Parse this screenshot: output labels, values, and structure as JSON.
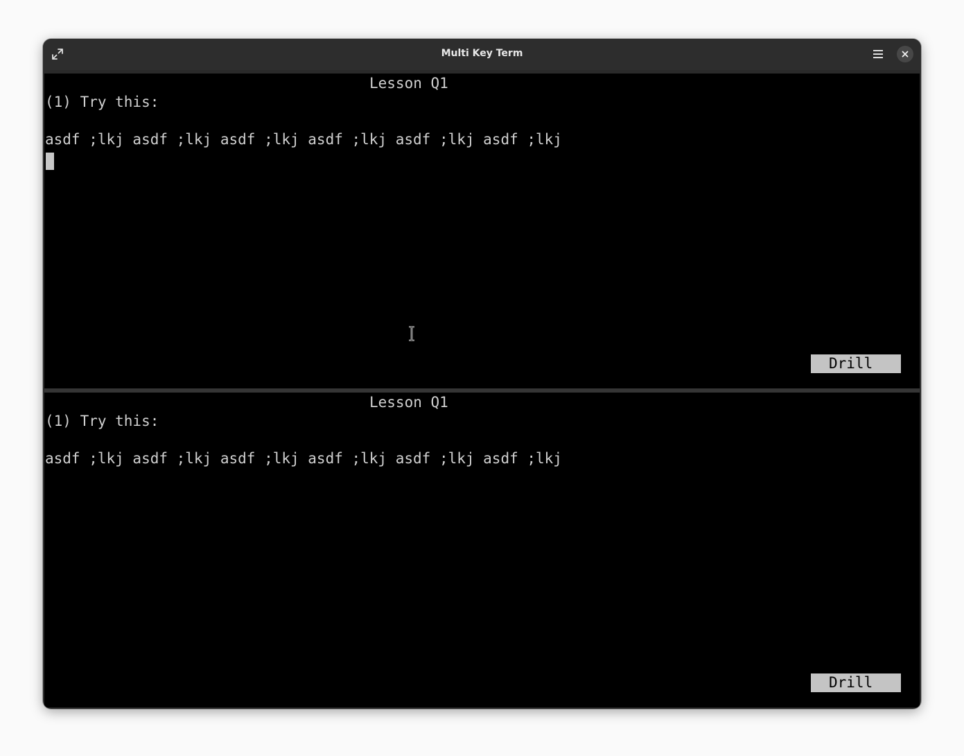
{
  "window": {
    "title": "Multi Key Term"
  },
  "titlebar": {
    "expand_icon": "expand-icon",
    "menu_icon": "hamburger-menu-icon",
    "close_icon": "close-icon"
  },
  "panes": [
    {
      "lesson_title": "Lesson Q1",
      "instruction": "(1) Try this:",
      "drill_text": "asdf ;lkj asdf ;lkj asdf ;lkj asdf ;lkj asdf ;lkj asdf ;lkj",
      "mode_label": "Drill"
    },
    {
      "lesson_title": "Lesson Q1",
      "instruction": "(1) Try this:",
      "drill_text": "asdf ;lkj asdf ;lkj asdf ;lkj asdf ;lkj asdf ;lkj asdf ;lkj",
      "mode_label": "Drill"
    }
  ],
  "colors": {
    "terminal_bg": "#000000",
    "terminal_fg": "#d0d0d0",
    "status_bg": "#c4c4c4",
    "titlebar_bg": "#2d2d2d"
  }
}
